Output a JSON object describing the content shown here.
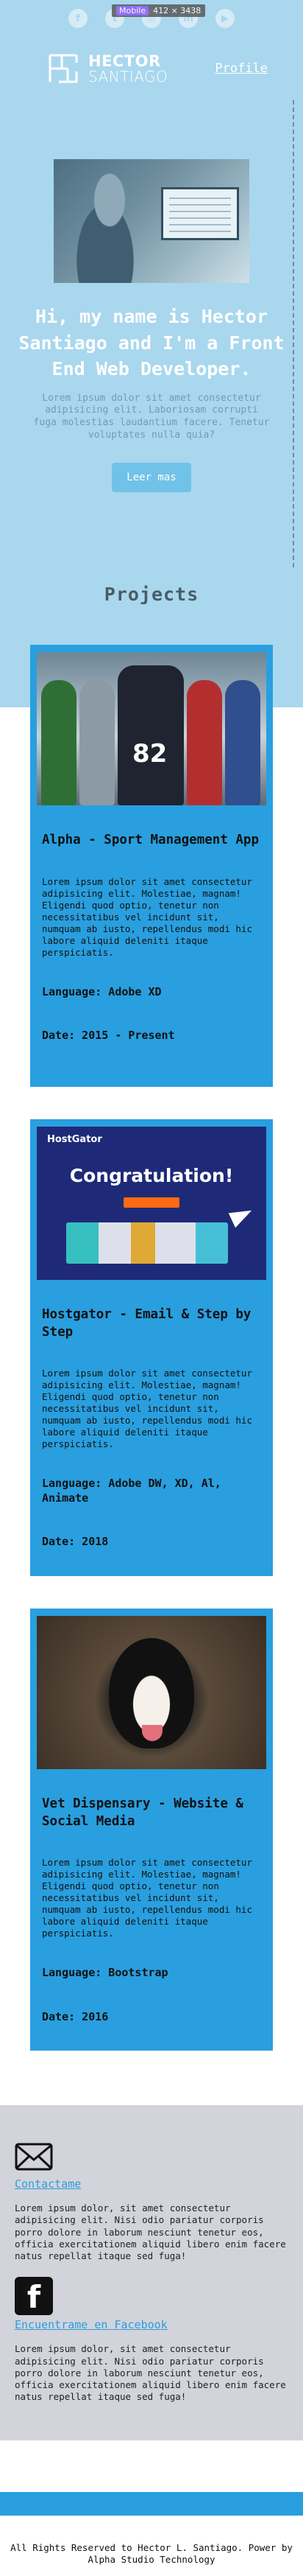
{
  "social": {
    "items": [
      {
        "name": "facebook",
        "glyph": "f"
      },
      {
        "name": "twitter",
        "glyph": "t"
      },
      {
        "name": "instagram",
        "glyph": "◎"
      },
      {
        "name": "linkedin",
        "glyph": "in"
      },
      {
        "name": "youtube",
        "glyph": "▶"
      }
    ]
  },
  "overlay": {
    "tag": "Mobile",
    "size": "412 × 3438"
  },
  "header": {
    "logo_line1": "HECTOR",
    "logo_line2": "SANTIAGO",
    "nav_profile": "Profile"
  },
  "hero": {
    "title": "Hi, my name is Hector Santiago and I'm a Front End Web Developer.",
    "text": "Lorem ipsum dolor sit amet consectetur adipisicing elit. Laboriosam corrupti fuga molestias laudantium facere. Tenetur voluptates nulla quia?",
    "button": "Leer mas"
  },
  "projects": {
    "title": "Projects",
    "items": [
      {
        "title": "Alpha - Sport Management App",
        "desc": "Lorem ipsum dolor sit amet consectetur adipisicing elit. Molestiae, magnam! Eligendi quod optio, tenetur non necessitatibus vel incidunt sit, numquam ab iusto, repellendus modi hic labore aliquid deleniti itaque perspiciatis.",
        "language": "Language: Adobe XD",
        "date": "Date: 2015 - Present"
      },
      {
        "title": "Hostgator - Email & Step by Step",
        "desc": "Lorem ipsum dolor sit amet consectetur adipisicing elit. Molestiae, magnam! Eligendi quod optio, tenetur non necessitatibus vel incidunt sit, numquam ab iusto, repellendus modi hic labore aliquid deleniti itaque perspiciatis.",
        "language": "Language: Adobe DW, XD, Al, Animate",
        "date": "Date: 2018",
        "image_brand": "HostGator",
        "image_headline": "Congratulation!"
      },
      {
        "title": "Vet Dispensary - Website & Social Media",
        "desc": "Lorem ipsum dolor sit amet consectetur adipisicing elit. Molestiae, magnam! Eligendi quod optio, tenetur non necessitatibus vel incidunt sit, numquam ab iusto, repellendus modi hic labore aliquid deleniti itaque perspiciatis.",
        "language": "Language: Bootstrap",
        "date": "Date: 2016"
      }
    ]
  },
  "contact": {
    "email_link": "Contactame",
    "email_text": "Lorem ipsum dolor, sit amet consectetur adipisicing elit. Nisi odio pariatur corporis porro dolore in laborum nesciunt tenetur eos, officia exercitationem aliquid libero enim facere natus repellat itaque sed fuga!",
    "facebook_link": "Encuentrame en Facebook",
    "facebook_text": "Lorem ipsum dolor, sit amet consectetur adipisicing elit. Nisi odio pariatur corporis porro dolore in laborum nesciunt tenetur eos, officia exercitationem aliquid libero enim facere natus repellat itaque sed fuga!"
  },
  "footer": {
    "text": "All Rights Reserved to Hector L. Santiago. Power by Alpha Studio Technology"
  },
  "colors": {
    "sky": "#a9d7ee",
    "card": "#299fdf",
    "contact_bg": "#d2d3db",
    "button": "#71c2e8"
  }
}
